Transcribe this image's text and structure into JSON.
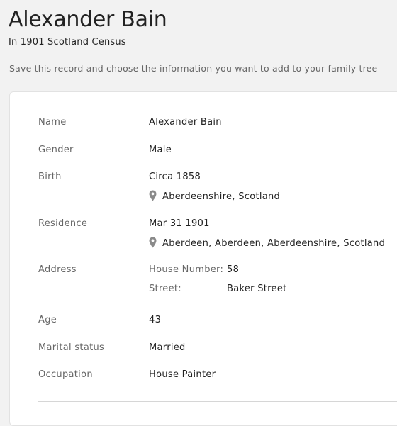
{
  "header": {
    "title": "Alexander Bain",
    "subtitle": "In 1901 Scotland Census",
    "instructions": "Save this record and choose the information you want to add to your family tree"
  },
  "record": {
    "name": {
      "label": "Name",
      "value": "Alexander Bain"
    },
    "gender": {
      "label": "Gender",
      "value": "Male"
    },
    "birth": {
      "label": "Birth",
      "date": "Circa 1858",
      "place": "Aberdeenshire, Scotland"
    },
    "residence": {
      "label": "Residence",
      "date": "Mar 31 1901",
      "place": "Aberdeen, Aberdeen, Aberdeenshire, Scotland"
    },
    "address": {
      "label": "Address",
      "house_number_label": "House Number:",
      "house_number": "58",
      "street_label": "Street:",
      "street": "Baker Street"
    },
    "age": {
      "label": "Age",
      "value": "43"
    },
    "marital_status": {
      "label": "Marital status",
      "value": "Married"
    },
    "occupation": {
      "label": "Occupation",
      "value": "House Painter"
    }
  },
  "icons": {
    "place_marker": "map-pin-icon"
  },
  "colors": {
    "page_background": "#f2f2f2",
    "card_background": "#ffffff",
    "label_text": "#666666",
    "value_text": "#222222",
    "pin_icon": "#8a8a8a"
  }
}
